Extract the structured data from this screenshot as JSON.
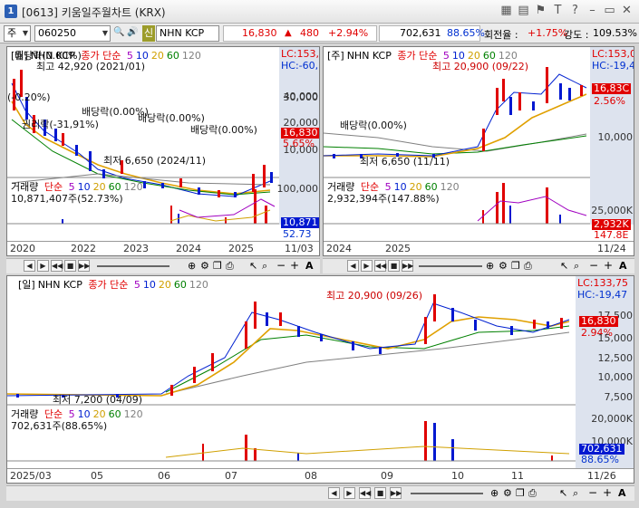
{
  "window": {
    "number": "1",
    "title": "[0613] 키움일주월차트 (KRX)",
    "icons": [
      "grid-icon",
      "layout-icon",
      "bookmark-icon",
      "font-icon",
      "question-icon",
      "minimize-icon",
      "restore-icon",
      "close-icon"
    ]
  },
  "toolbar": {
    "type_select": "주",
    "code": "060250",
    "sin_badge": "신",
    "name": "NHN KCP",
    "price": "16,830",
    "arrow": "▲",
    "change": "480",
    "change_pct": "+2.94%",
    "volume": "702,631",
    "vol_pct": "88.65%",
    "turnover_label": "회전율 :",
    "turnover": "+1.75%",
    "strength_label": "강도 :",
    "strength": "109.53%"
  },
  "panel_month": {
    "header": {
      "type": "[월]",
      "name": "NHN KCP",
      "label": "종가 단순",
      "ma": [
        "5",
        "10",
        "20",
        "60",
        "120"
      ]
    },
    "lc": "LC:153,0",
    "hc": "HC:-60,1",
    "price_tag": "16,830",
    "pct_tag": "5.65%",
    "y_ticks": [
      "40,000",
      "30,000",
      "20,000",
      "10,000"
    ],
    "annotations": {
      "max": "최고 42,920 (2021/01)",
      "min": "최저 6,650 (2024/11)",
      "rights": "권리락(-31,91%)",
      "pct": "(-0.20%)",
      "div1": "배당락(0.00%)",
      "div2": "배당락(0.00%)",
      "div3": "배당락(0.00%)",
      "div4": "배당락(0.00%)",
      "top_left": "배당락(0.00%)"
    },
    "vol_header": {
      "label": "거래량",
      "type": "단순",
      "ma": [
        "5",
        "10",
        "20",
        "60",
        "120"
      ]
    },
    "vol_value": "10,871,407주(52.73%)",
    "vol_ticks": [
      "100,000"
    ],
    "vol_tag": "10,871",
    "vol_pct_tag": "52.73",
    "x_labels": [
      "2020",
      "2022",
      "2023",
      "2024",
      "2025",
      "11/03"
    ]
  },
  "panel_week": {
    "header": {
      "type": "[주]",
      "name": "NHN KCP",
      "label": "종가 단순",
      "ma": [
        "5",
        "10",
        "20",
        "60",
        "120"
      ]
    },
    "lc": "LC:153,0",
    "hc": "HC:-19,4",
    "price_tag": "16,83C",
    "pct_tag": "2.56%",
    "y_ticks": [
      "10,000"
    ],
    "annotations": {
      "max": "최고 20,900 (09/22)",
      "min": "최저 6,650 (11/11)",
      "div": "배당락(0.00%)"
    },
    "vol_header": {
      "label": "거래량",
      "type": "단순",
      "ma": [
        "5",
        "10",
        "20",
        "60",
        "120"
      ]
    },
    "vol_value": "2,932,394주(147.88%)",
    "vol_ticks": [
      "25,000K"
    ],
    "vol_tag": "2,932K",
    "vol_pct_tag": "147.8E",
    "x_labels": [
      "2024",
      "2025",
      "11/24"
    ]
  },
  "panel_day": {
    "header": {
      "type": "[일]",
      "name": "NHN KCP",
      "label": "종가 단순",
      "ma": [
        "5",
        "10",
        "20",
        "60",
        "120"
      ]
    },
    "lc": "LC:133,75",
    "hc": "HC:-19,47",
    "price_tag": "16,830",
    "pct_tag": "2.94%",
    "y_ticks": [
      "17,500",
      "15,000",
      "12,500",
      "10,000",
      "7,500"
    ],
    "annotations": {
      "max": "최고 20,900 (09/26)",
      "min": "최저 7,200 (04/09)"
    },
    "vol_header": {
      "label": "거래량",
      "type": "단순",
      "ma": [
        "5",
        "10",
        "20",
        "60",
        "120"
      ]
    },
    "vol_value": "702,631주(88.65%)",
    "vol_ticks": [
      "20,000K",
      "10,000K"
    ],
    "vol_tag": "702,631",
    "vol_pct_tag": "88.65%",
    "x_labels": [
      "2025/03",
      "05",
      "06",
      "07",
      "08",
      "09",
      "10",
      "11",
      "11/26"
    ]
  },
  "nav_buttons": [
    "◀",
    "▶",
    "◀◀",
    "■",
    "▶▶"
  ],
  "nav_tools": [
    "crosshair-icon",
    "settings-icon",
    "copy-icon",
    "print-icon",
    "cursor-icon",
    "zoom-icon",
    "minus-icon",
    "plus-icon",
    "font-size-icon"
  ],
  "colors": {
    "up": "#e00000",
    "down": "#0018d0",
    "ma5": "#a000c0",
    "ma10": "#0020d0",
    "ma20": "#e0a000",
    "ma60": "#008000",
    "ma120": "#808080"
  }
}
